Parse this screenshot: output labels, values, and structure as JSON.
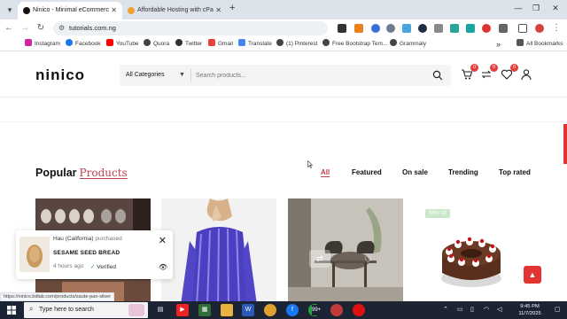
{
  "browser": {
    "tabs": [
      {
        "title": "Ninico - Minimal eCommerce",
        "active": true
      },
      {
        "title": "Affordable Hosting with cPanel",
        "active": false
      }
    ],
    "url": "tutorials.com.ng",
    "bookmarks": [
      "Instagram",
      "Facebook",
      "YouTube",
      "Quora",
      "Twitter",
      "Gmail",
      "Translate",
      "(1) Pinterest",
      "Free Bootstrap Tem...",
      "Grammaly"
    ],
    "all_bookmarks": "All Bookmarks",
    "more_bookmarks": "»"
  },
  "header": {
    "logo": "ninico",
    "category_select": "All Categories",
    "search_placeholder": "Search products...",
    "cart_count": "0",
    "compare_count": "0",
    "wishlist_count": "0"
  },
  "section": {
    "title": "Popular",
    "title_accent": "Products",
    "filters": [
      "All",
      "Featured",
      "On sale",
      "Trending",
      "Top rated"
    ],
    "active_filter": "All"
  },
  "products": [
    {
      "image": "yarn-shelves",
      "badge": ""
    },
    {
      "image": "purple-striped-shirt",
      "badge": ""
    },
    {
      "image": "chairs-interior",
      "badge": ""
    },
    {
      "image": "black-forest-cake",
      "badge": "56% off"
    }
  ],
  "toast": {
    "buyer": "Hau (California)",
    "verb": "purchased",
    "product": "SESAME SEED BREAD",
    "time": "4 hours ago",
    "verified": "Verified"
  },
  "status_url": "https://ninico.bdlab.com/products/saute-pan-silver",
  "taskbar": {
    "search_text": "Type here to search",
    "notification_badge": "99+",
    "time": "9:45 PM",
    "date": "11/7/2025"
  },
  "colors": {
    "accent": "#c04050",
    "badge_red": "#e43f3f",
    "scroll_red": "#e33434",
    "discount_green": "#c9e7c9",
    "taskbar": "#1c2433"
  }
}
